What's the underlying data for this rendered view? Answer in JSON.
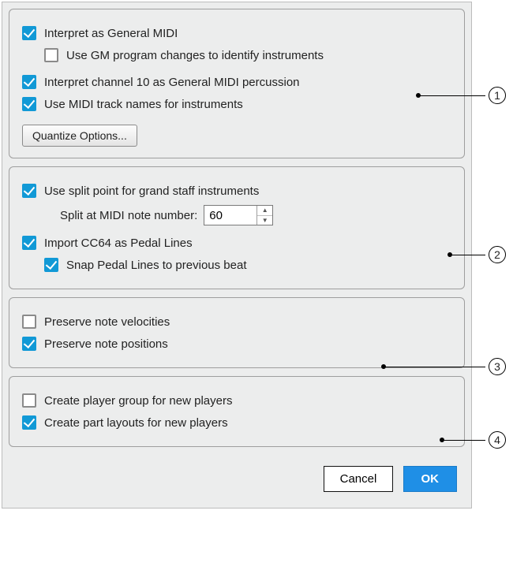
{
  "group1": {
    "interpret_general_midi": "Interpret as General MIDI",
    "use_gm_program_changes": "Use GM program changes to identify instruments",
    "interpret_channel_10": "Interpret channel 10 as General MIDI percussion",
    "use_midi_track_names": "Use MIDI track names for instruments",
    "quantize_button": "Quantize Options..."
  },
  "group2": {
    "use_split_point": "Use split point for grand staff instruments",
    "split_label": "Split at MIDI note number:",
    "split_value": "60",
    "import_cc64": "Import CC64 as Pedal Lines",
    "snap_pedal": "Snap Pedal Lines to previous beat"
  },
  "group3": {
    "preserve_velocities": "Preserve note velocities",
    "preserve_positions": "Preserve note positions"
  },
  "group4": {
    "create_player_group": "Create player group for new players",
    "create_part_layouts": "Create part layouts for new players"
  },
  "footer": {
    "cancel": "Cancel",
    "ok": "OK"
  },
  "callouts": [
    "1",
    "2",
    "3",
    "4"
  ]
}
